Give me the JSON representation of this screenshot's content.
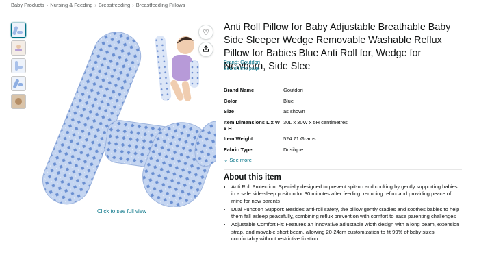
{
  "breadcrumb": [
    "Baby Products",
    "Nursing & Feeding",
    "Breastfeeding",
    "Breastfeeding Pillows"
  ],
  "product": {
    "title": "Anti Roll Pillow for Baby Adjustable Breathable Baby Side Sleeper Wedge Removable Washable Reflux Pillow for Babies Blue Anti Roll for, Wedge for Newborn, Side Slee",
    "brand_link": "Brand: Goutdori",
    "search_link": "Search this page",
    "full_view_link": "Click to see full view"
  },
  "specs": [
    {
      "key": "Brand Name",
      "value": "Goutdori"
    },
    {
      "key": "Color",
      "value": "Blue"
    },
    {
      "key": "Size",
      "value": "as shown"
    },
    {
      "key": "Item Dimensions L x W x H",
      "value": "30L x 30W x 5H centimetres"
    },
    {
      "key": "Item Weight",
      "value": "524.71 Grams"
    },
    {
      "key": "Fabric Type",
      "value": "Drisilque"
    }
  ],
  "see_more": "See more",
  "about": {
    "heading": "About this item",
    "bullets": [
      "Anti Roll Protection: Specially designed to prevent spit-up and choking by gently supporting babies in a safe side-sleep position for 30 minutes after feeding, reducing reflux and providing peace of mind for new parents",
      "Dual Function Support: Besides anti-roll safety, the pillow gently cradles and soothes babies to help them fall asleep peacefully, combining reflux prevention with comfort to ease parenting challenges",
      "Adjustable Comfort Fit: Features an innovative adjustable width design with a long beam, extension strap, and movable short beam, allowing 20-24cm customization to fit 99% of baby sizes comfortably without restrictive fixation"
    ]
  },
  "colors": {
    "link": "#007185",
    "pillow": "#b9cdee",
    "pattern": "#5a7fc8"
  },
  "icons": {
    "wishlist": "heart-icon",
    "share": "share-icon"
  }
}
